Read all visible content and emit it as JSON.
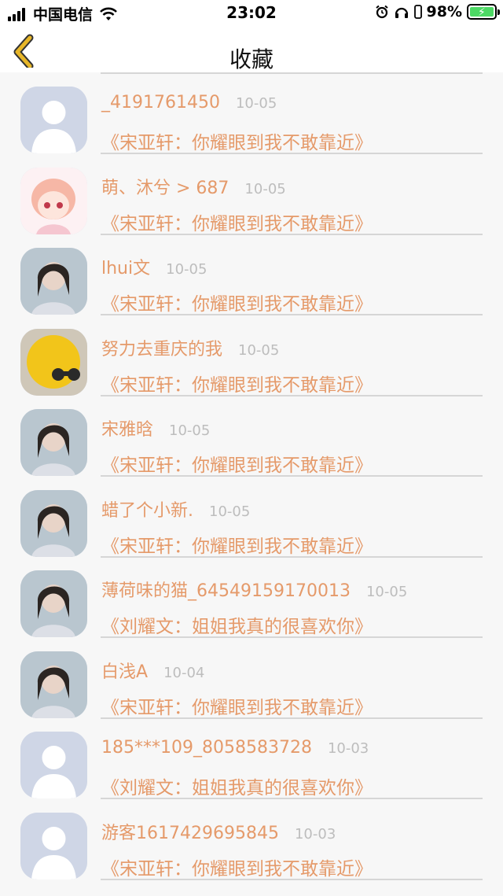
{
  "status_bar": {
    "carrier": "中国电信",
    "time": "23:02",
    "battery": "98%"
  },
  "nav": {
    "title": "收藏"
  },
  "items": [
    {
      "name": "_4191761450",
      "date": "10-05",
      "work": "《宋亚轩：你耀眼到我不敢靠近》",
      "avatar": "default-avatar"
    },
    {
      "name": "萌、沐兮 > 687",
      "date": "10-05",
      "work": "《宋亚轩：你耀眼到我不敢靠近》",
      "avatar": "anime-girl-avatar"
    },
    {
      "name": "lhui文",
      "date": "10-05",
      "work": "《宋亚轩：你耀眼到我不敢靠近》",
      "avatar": "photo-avatar"
    },
    {
      "name": "努力去重庆的我",
      "date": "10-05",
      "work": "《宋亚轩：你耀眼到我不敢靠近》",
      "avatar": "yellow-chick-avatar"
    },
    {
      "name": "宋雅晗",
      "date": "10-05",
      "work": "《宋亚轩：你耀眼到我不敢靠近》",
      "avatar": "photo-avatar"
    },
    {
      "name": "蜡了个小新.",
      "date": "10-05",
      "work": "《宋亚轩：你耀眼到我不敢靠近》",
      "avatar": "photo-avatar"
    },
    {
      "name": "薄荷味的猫_64549159170013",
      "date": "10-05",
      "work": "《刘耀文：姐姐我真的很喜欢你》",
      "avatar": "photo-avatar"
    },
    {
      "name": "白浅A",
      "date": "10-04",
      "work": "《宋亚轩：你耀眼到我不敢靠近》",
      "avatar": "photo-avatar"
    },
    {
      "name": "185***109_8058583728",
      "date": "10-03",
      "work": "《刘耀文：姐姐我真的很喜欢你》",
      "avatar": "default-avatar"
    },
    {
      "name": "游客1617429695845",
      "date": "10-03",
      "work": "《宋亚轩：你耀眼到我不敢靠近》",
      "avatar": "default-avatar"
    }
  ],
  "colors": {
    "accent": "#e59a6a",
    "date": "#bdbdbd",
    "back_arrow": "#e7b628"
  }
}
